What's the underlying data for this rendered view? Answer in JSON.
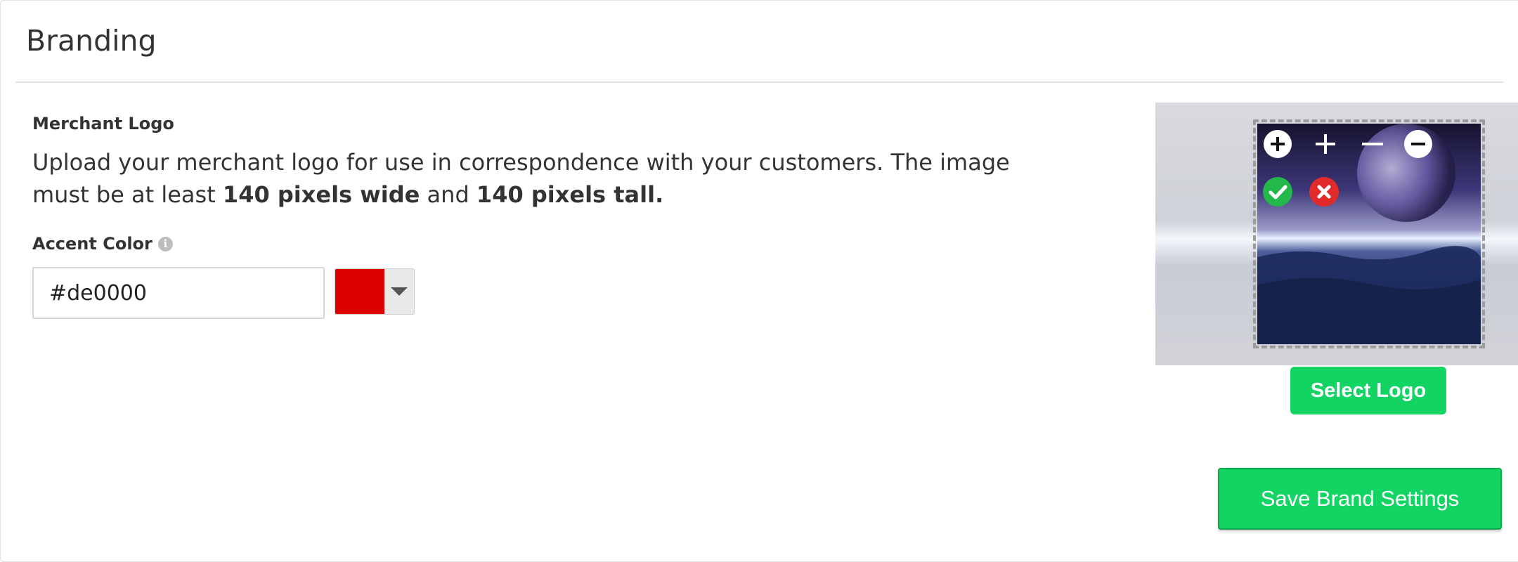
{
  "panel": {
    "title": "Branding"
  },
  "merchant_logo": {
    "label": "Merchant Logo",
    "desc_prefix": "Upload your merchant logo for use in correspondence with your customers. The image must be at least ",
    "desc_bold_width": "140 pixels wide",
    "desc_middle": " and ",
    "desc_bold_height": "140 pixels tall."
  },
  "accent_color": {
    "label": "Accent Color",
    "info_icon": "info-icon",
    "value": "#de0000",
    "swatch_color": "#de0000"
  },
  "logo_editor": {
    "tools": [
      "zoom-in-icon",
      "plus-icon",
      "minus-icon",
      "zoom-out-icon",
      "confirm-icon",
      "cancel-icon"
    ]
  },
  "buttons": {
    "select_logo": "Select Logo",
    "save": "Save Brand Settings"
  },
  "colors": {
    "accent_green": "#12d463"
  }
}
